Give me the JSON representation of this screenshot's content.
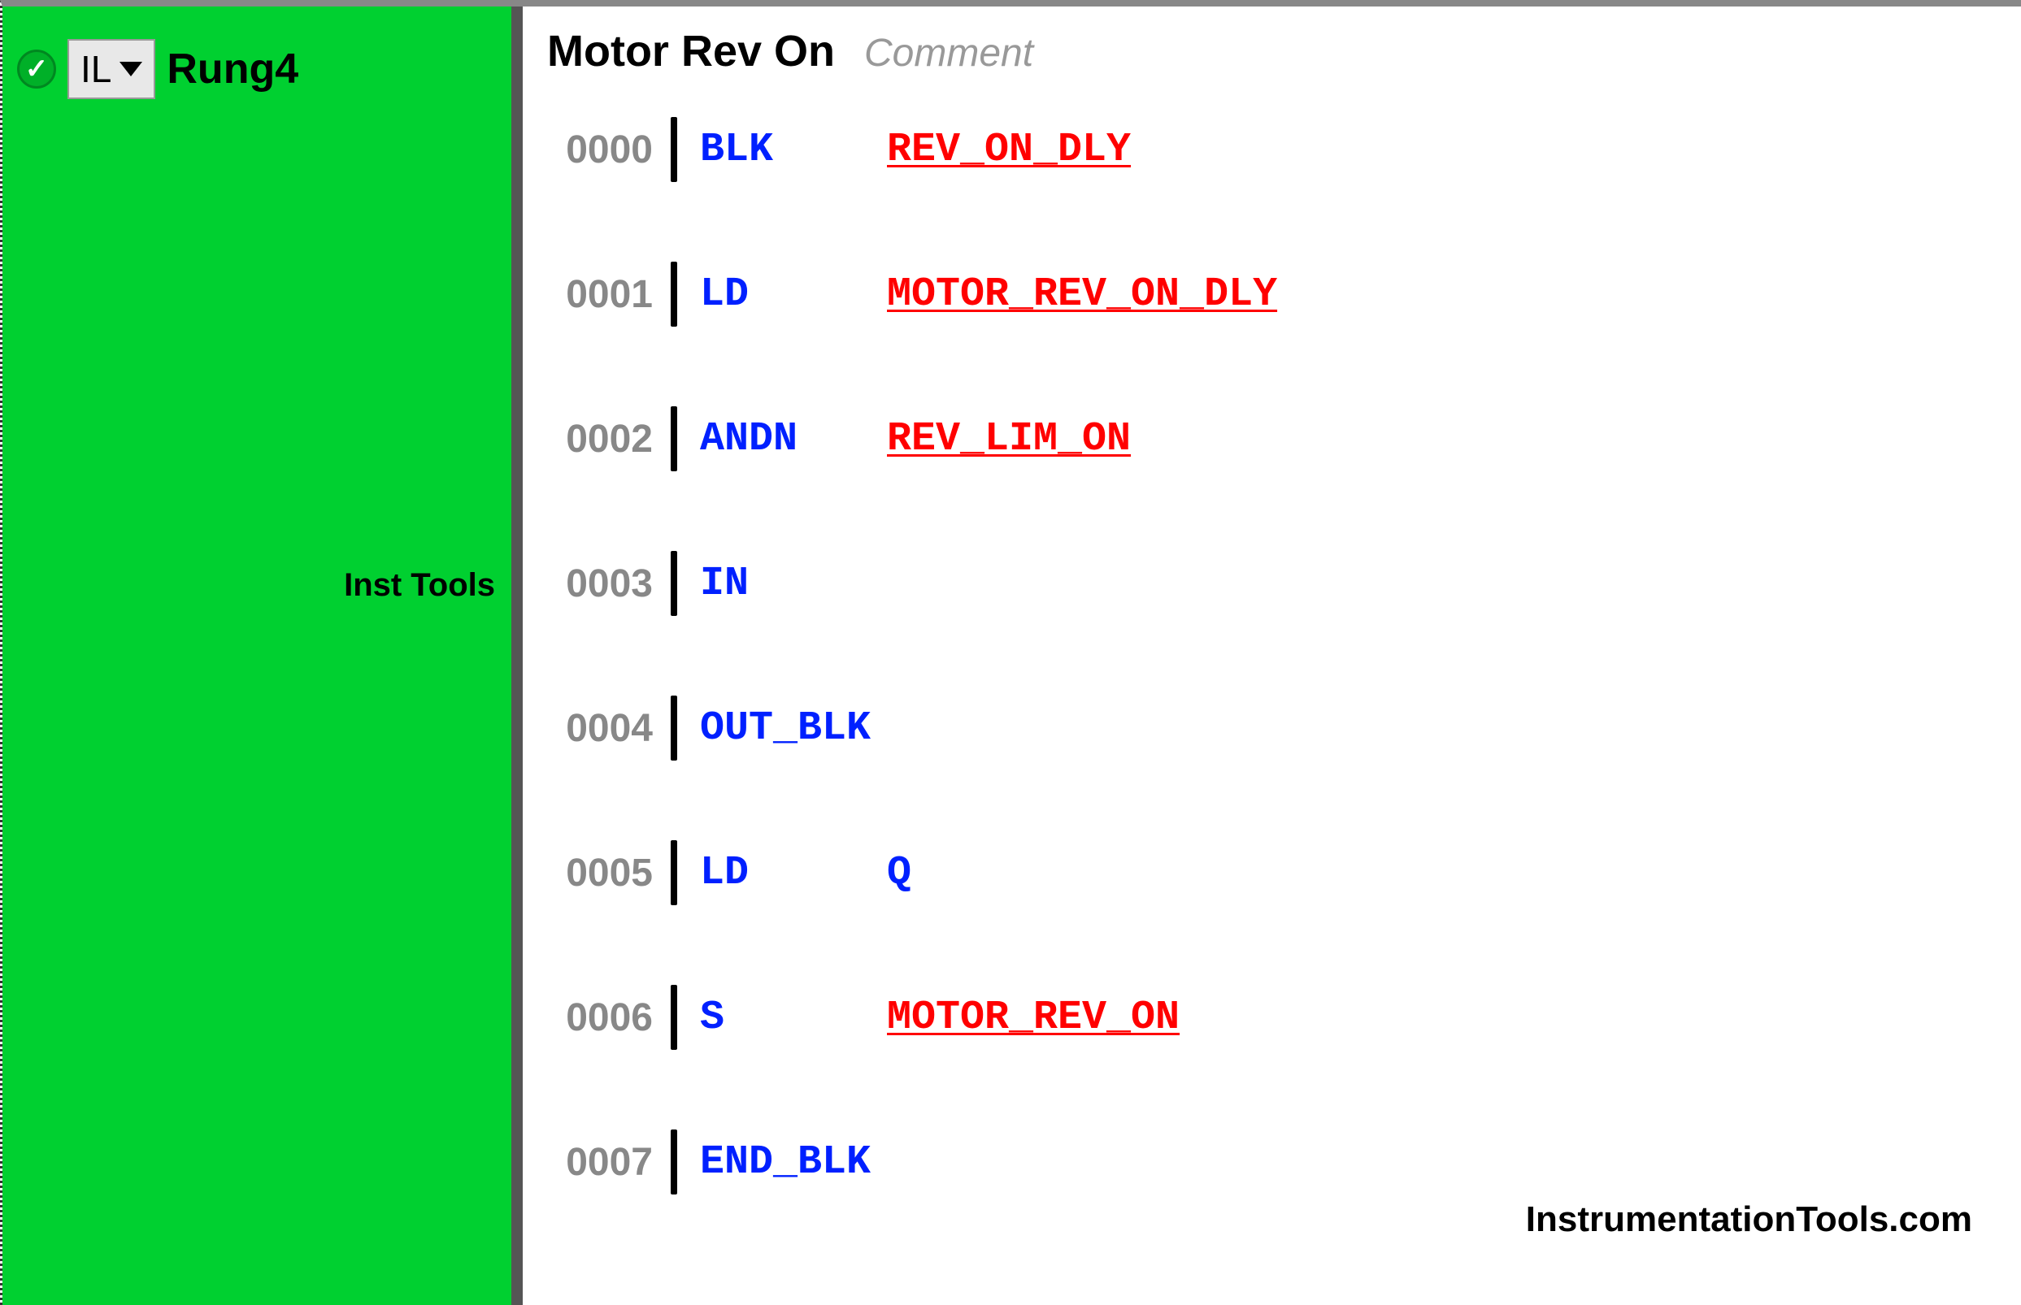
{
  "sidebar": {
    "lang_label": "IL",
    "rung_name": "Rung4",
    "watermark": "Inst Tools"
  },
  "header": {
    "title": "Motor Rev On",
    "comment_placeholder": "Comment"
  },
  "lines": [
    {
      "num": "0000",
      "instr": "BLK",
      "operand": "REV_ON_DLY",
      "operand_color": "red"
    },
    {
      "num": "0001",
      "instr": "LD",
      "operand": "MOTOR_REV_ON_DLY",
      "operand_color": "red"
    },
    {
      "num": "0002",
      "instr": "ANDN",
      "operand": "REV_LIM_ON",
      "operand_color": "red"
    },
    {
      "num": "0003",
      "instr": "IN",
      "operand": "",
      "operand_color": ""
    },
    {
      "num": "0004",
      "instr": "OUT_BLK",
      "operand": "",
      "operand_color": ""
    },
    {
      "num": "0005",
      "instr": "LD",
      "operand": "Q",
      "operand_color": "blue"
    },
    {
      "num": "0006",
      "instr": "S",
      "operand": "MOTOR_REV_ON",
      "operand_color": "red"
    },
    {
      "num": "0007",
      "instr": "END_BLK",
      "operand": "",
      "operand_color": ""
    }
  ],
  "footer": {
    "watermark": "InstrumentationTools.com"
  }
}
